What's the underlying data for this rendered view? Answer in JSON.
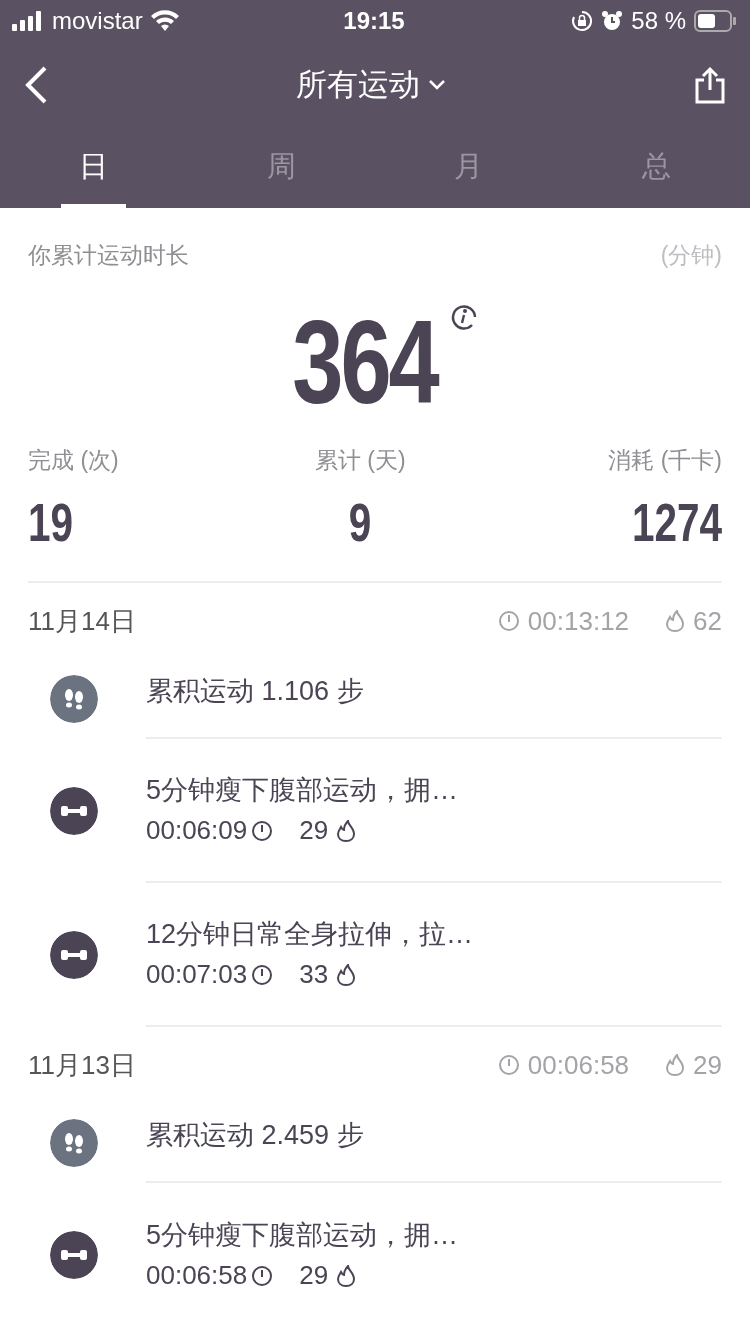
{
  "status_bar": {
    "carrier": "movistar",
    "time": "19:15",
    "battery_text": "58 %"
  },
  "nav": {
    "title": "所有运动"
  },
  "tabs": [
    {
      "label": "日",
      "selected": true
    },
    {
      "label": "周",
      "selected": false
    },
    {
      "label": "月",
      "selected": false
    },
    {
      "label": "总",
      "selected": false
    }
  ],
  "summary": {
    "label": "你累计运动时长",
    "unit": "(分钟)",
    "total": "364",
    "stats": [
      {
        "label": "完成 (次)",
        "value": "19"
      },
      {
        "label": "累计 (天)",
        "value": "9"
      },
      {
        "label": "消耗 (千卡)",
        "value": "1274"
      }
    ]
  },
  "days": [
    {
      "date": "11月14日",
      "duration": "00:13:12",
      "calories": "62",
      "entries": [
        {
          "kind": "steps",
          "title": "累积运动 1.106 步"
        },
        {
          "kind": "workout",
          "title": "5分钟瘦下腹部运动，拥…",
          "duration": "00:06:09",
          "calories": "29"
        },
        {
          "kind": "workout",
          "title": "12分钟日常全身拉伸，拉…",
          "duration": "00:07:03",
          "calories": "33"
        }
      ]
    },
    {
      "date": "11月13日",
      "duration": "00:06:58",
      "calories": "29",
      "entries": [
        {
          "kind": "steps",
          "title": "累积运动 2.459 步"
        },
        {
          "kind": "workout",
          "title": "5分钟瘦下腹部运动，拥…",
          "duration": "00:06:58",
          "calories": "29"
        }
      ]
    }
  ]
}
